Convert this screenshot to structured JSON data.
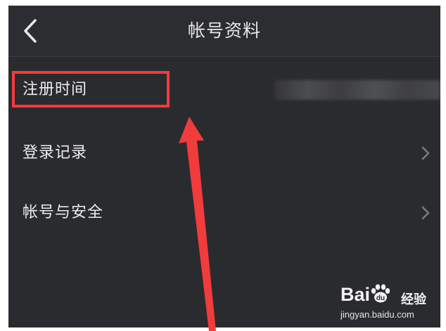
{
  "header": {
    "title": "帐号资料",
    "back_icon": "chevron-left-icon"
  },
  "rows": [
    {
      "label": "注册时间",
      "value_redacted": true
    },
    {
      "label": "登录记录",
      "icon": "chevron-right-icon"
    },
    {
      "label": "帐号与安全",
      "icon": "chevron-right-icon"
    }
  ],
  "annotation": {
    "highlight_color": "#f23b3b",
    "arrow_color": "#f23b3b"
  },
  "watermark": {
    "brand_bai": "Bai",
    "brand_du": "du",
    "brand_suffix": "经验",
    "url": "jingyan.baidu.com"
  }
}
